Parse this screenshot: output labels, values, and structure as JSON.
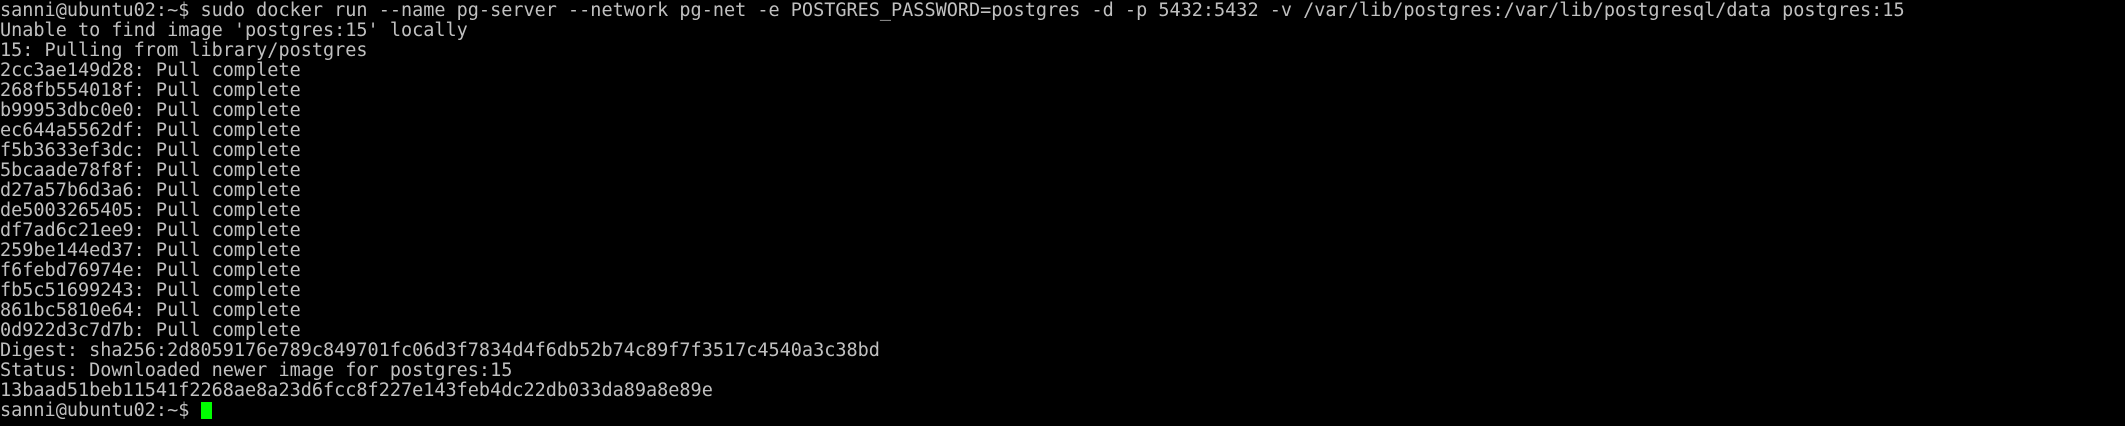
{
  "terminal": {
    "colors": {
      "background": "#000000",
      "foreground": "#c0c0c0",
      "cursor": "#00ff00"
    },
    "lines": [
      "sanni@ubuntu02:~$ sudo docker run --name pg-server --network pg-net -e POSTGRES_PASSWORD=postgres -d -p 5432:5432 -v /var/lib/postgres:/var/lib/postgresql/data postgres:15",
      "Unable to find image 'postgres:15' locally",
      "15: Pulling from library/postgres",
      "2cc3ae149d28: Pull complete",
      "268fb554018f: Pull complete",
      "b99953dbc0e0: Pull complete",
      "ec644a5562df: Pull complete",
      "f5b3633ef3dc: Pull complete",
      "5bcaade78f8f: Pull complete",
      "d27a57b6d3a6: Pull complete",
      "de5003265405: Pull complete",
      "df7ad6c21ee9: Pull complete",
      "259be144ed37: Pull complete",
      "f6febd76974e: Pull complete",
      "fb5c51699243: Pull complete",
      "861bc5810e64: Pull complete",
      "0d922d3c7d7b: Pull complete",
      "Digest: sha256:2d8059176e789c849701fc06d3f7834d4f6db52b74c89f7f3517c4540a3c38bd",
      "Status: Downloaded newer image for postgres:15",
      "13baad51beb11541f2268ae8a23d6fcc8f227e143feb4dc22db033da89a8e89e"
    ],
    "prompt": "sanni@ubuntu02:~$ "
  }
}
